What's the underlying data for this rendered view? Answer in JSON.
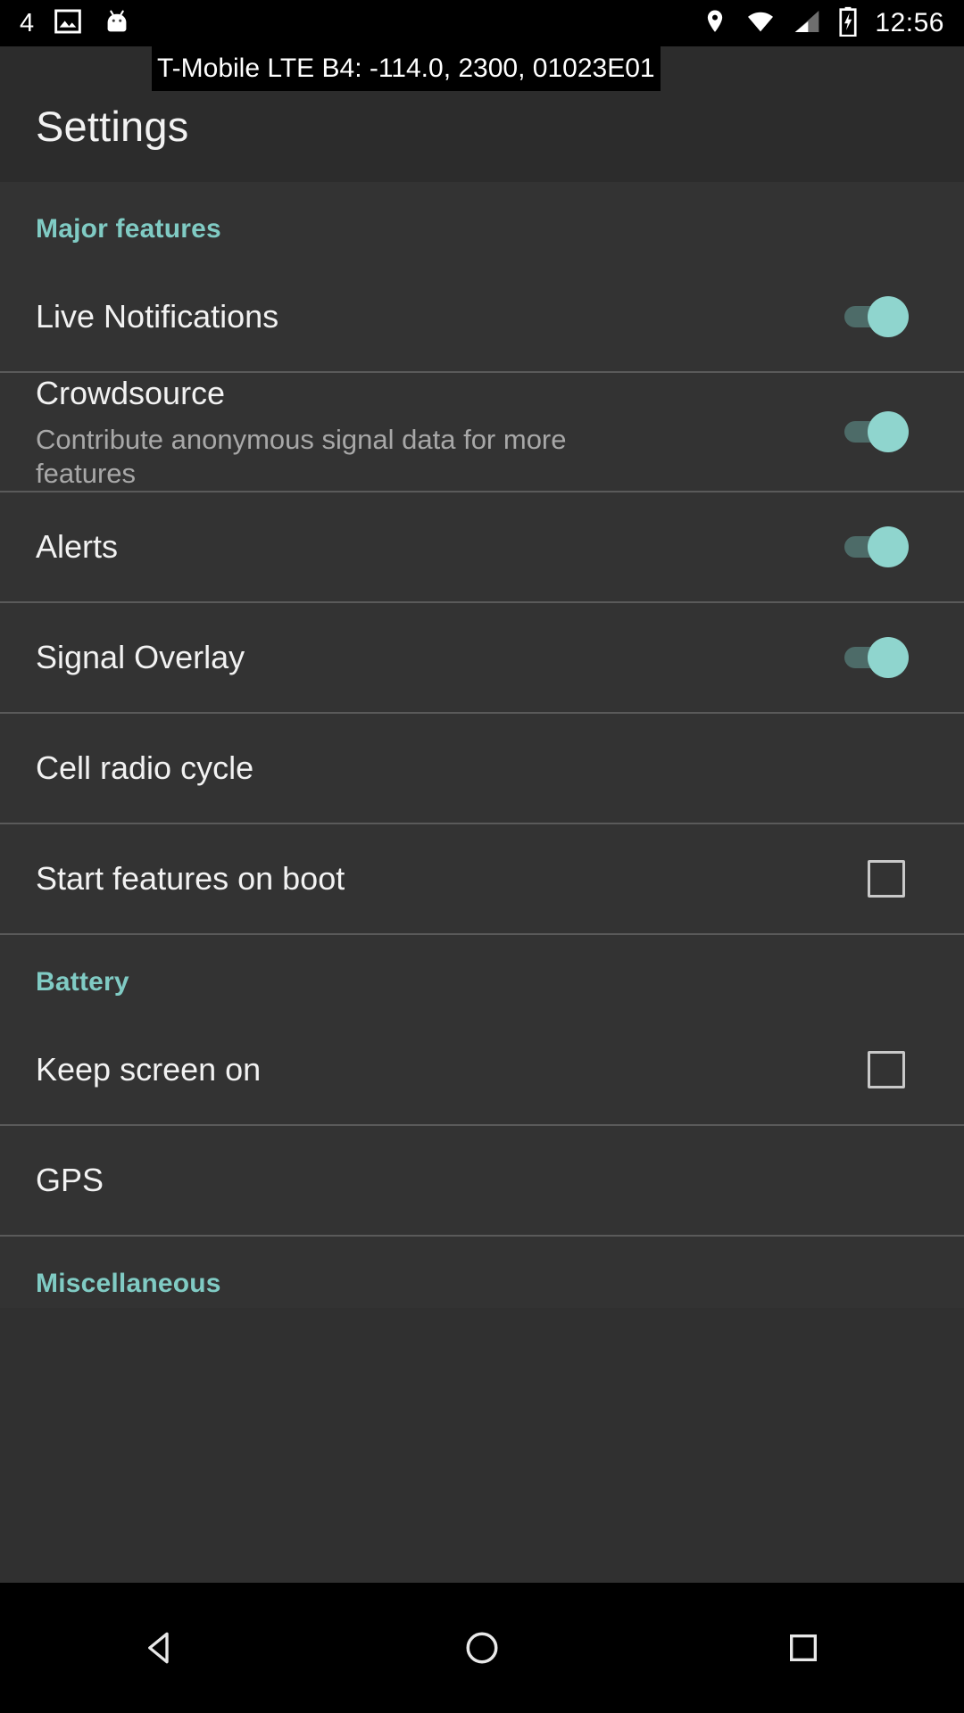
{
  "status_bar": {
    "notification_count": "4",
    "time": "12:56",
    "left_icons": [
      "photo-icon",
      "android-head-icon"
    ],
    "right_icons": [
      "location-pin-icon",
      "wifi-icon",
      "cellular-signal-icon",
      "battery-charging-icon"
    ]
  },
  "header": {
    "title": "Settings",
    "signal_overlay": "T-Mobile LTE B4: -114.0, 2300, 01023E01"
  },
  "colors": {
    "accent": "#80cbc4",
    "background": "#333333",
    "header_background": "#2c2c2c",
    "status_bar_background": "#000000",
    "primary_text": "#f2f2f2",
    "secondary_text": "#a8a8a8",
    "divider": "#5a5a5a",
    "toggle_track_on": "#4d6b68",
    "toggle_thumb_on": "#8fd5ce",
    "checkbox_border": "#c9c9c9"
  },
  "sections": [
    {
      "id": "major-features",
      "label": "Major features",
      "rows": [
        {
          "id": "live-notifications",
          "title": "Live Notifications",
          "subtitle": "",
          "control": "toggle",
          "value": "on"
        },
        {
          "id": "crowdsource",
          "title": "Crowdsource",
          "subtitle": "Contribute anonymous signal data for more features",
          "control": "toggle",
          "value": "on"
        },
        {
          "id": "alerts",
          "title": "Alerts",
          "subtitle": "",
          "control": "toggle",
          "value": "on"
        },
        {
          "id": "signal-overlay",
          "title": "Signal Overlay",
          "subtitle": "",
          "control": "toggle",
          "value": "on"
        },
        {
          "id": "cell-radio-cycle",
          "title": "Cell radio cycle",
          "subtitle": "",
          "control": "none",
          "value": ""
        },
        {
          "id": "start-features-on-boot",
          "title": "Start features on boot",
          "subtitle": "",
          "control": "checkbox",
          "value": "off"
        }
      ]
    },
    {
      "id": "battery",
      "label": "Battery",
      "rows": [
        {
          "id": "keep-screen-on",
          "title": "Keep screen on",
          "subtitle": "",
          "control": "checkbox",
          "value": "off"
        },
        {
          "id": "gps",
          "title": "GPS",
          "subtitle": "",
          "control": "none",
          "value": ""
        }
      ]
    },
    {
      "id": "miscellaneous",
      "label": "Miscellaneous",
      "rows": []
    }
  ],
  "nav_bar": {
    "back_label": "back-button",
    "home_label": "home-button",
    "recents_label": "recents-button"
  }
}
